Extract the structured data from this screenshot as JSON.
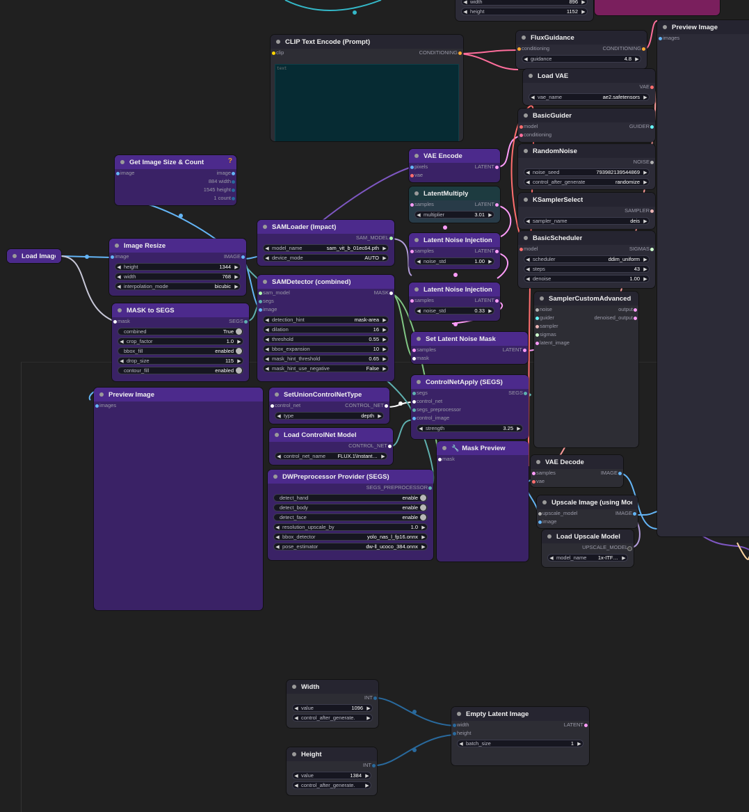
{
  "colors": {
    "canvas": "#202020",
    "image": "#64b5f6",
    "latent": "#ff9cf9",
    "conditioning": "#ffa931",
    "model": "#b39ddb",
    "mask": "#81c784",
    "segs": "#5fb1b0",
    "vae": "#ff6e6e",
    "sampler": "#ecb4b4",
    "noise": "#b0b0b0",
    "guider": "#66ffff",
    "sigmas": "#cdffcd",
    "int": "#29699c"
  },
  "nodes": {
    "top": {
      "width_label": "width",
      "width_value": "896",
      "height_label": "height",
      "height_value": "1152"
    },
    "clip": {
      "title": "CLIP Text Encode (Prompt)",
      "in_clip": "clip",
      "out_conditioning": "CONDITIONING",
      "text_placeholder": "text"
    },
    "flux": {
      "title": "FluxGuidance",
      "in_conditioning": "conditioning",
      "out_conditioning": "CONDITIONING",
      "guidance_label": "guidance",
      "guidance_value": "4.8"
    },
    "vae_loader": {
      "title": "Load VAE",
      "out_vae": "VAE",
      "vae_name_label": "vae_name",
      "vae_name_value": "ae2.safetensors"
    },
    "guider": {
      "title": "BasicGuider",
      "in_model": "model",
      "in_conditioning": "conditioning",
      "out_guider": "GUIDER"
    },
    "noise": {
      "title": "RandomNoise",
      "out_noise": "NOISE",
      "seed_label": "noise_seed",
      "seed_value": "793982139544869",
      "cag_label": "control_after_generate",
      "cag_value": "randomize"
    },
    "ksel": {
      "title": "KSamplerSelect",
      "out_sampler": "SAMPLER",
      "sampler_label": "sampler_name",
      "sampler_value": "deis"
    },
    "sched": {
      "title": "BasicScheduler",
      "in_model": "model",
      "out_sigmas": "SIGMAS",
      "scheduler_label": "scheduler",
      "scheduler_value": "ddim_uniform",
      "steps_label": "steps",
      "steps_value": "43",
      "denoise_label": "denoise",
      "denoise_value": "1.00"
    },
    "sca": {
      "title": "SamplerCustomAdvanced",
      "in_noise": "noise",
      "in_guider": "guider",
      "in_sampler": "sampler",
      "in_sigmas": "sigmas",
      "in_latent": "latent_image",
      "out_output": "output",
      "out_denoised": "denoised_output"
    },
    "preview_top": {
      "title": "Preview Image",
      "in_images": "images"
    },
    "size_count": {
      "title": "Get Image Size & Count",
      "badge": "?",
      "in_image": "image",
      "out_image": "image",
      "out_width": "884 width",
      "out_height": "1545 height",
      "out_count": "1 count"
    },
    "vae_encode": {
      "title": "VAE Encode",
      "in_pixels": "pixels",
      "in_vae": "vae",
      "out_latent": "LATENT"
    },
    "lat_mul": {
      "title": "LatentMultiply",
      "in_samples": "samples",
      "out_latent": "LATENT",
      "mult_label": "multiplier",
      "mult_value": "3.01"
    },
    "lni1": {
      "title": "Latent Noise Injection",
      "in_samples": "samples",
      "out_latent": "LATENT",
      "std_label": "noise_std",
      "std_value": "1.00"
    },
    "lni2": {
      "title": "Latent Noise Injection",
      "in_samples": "samples",
      "out_latent": "LATENT",
      "std_label": "noise_std",
      "std_value": "0.33"
    },
    "load_image": {
      "title": "Load Image"
    },
    "img_resize": {
      "title": "Image Resize",
      "in_image": "image",
      "out_image": "IMAGE",
      "height_label": "height",
      "height_value": "1344",
      "width_label": "width",
      "width_value": "768",
      "interp_label": "interpolation_mode",
      "interp_value": "bicubic"
    },
    "sam_loader": {
      "title": "SAMLoader (Impact)",
      "out_sam": "SAM_MODEL",
      "model_label": "model_name",
      "model_value": "sam_vit_b_01ec64.pth",
      "device_label": "device_mode",
      "device_value": "AUTO"
    },
    "sam_det": {
      "title": "SAMDetector (combined)",
      "in_sam": "sam_model",
      "in_segs": "segs",
      "in_image": "image",
      "out_mask": "MASK",
      "hint_label": "detection_hint",
      "hint_value": "mask-area",
      "dil_label": "dilation",
      "dil_value": "16",
      "thr_label": "threshold",
      "thr_value": "0.55",
      "bbox_label": "bbox_expansion",
      "bbox_value": "10",
      "mht_label": "mask_hint_threshold",
      "mht_value": "0.65",
      "neg_label": "mask_hint_use_negative",
      "neg_value": "False"
    },
    "mask_segs": {
      "title": "MASK to SEGS",
      "in_mask": "mask",
      "out_segs": "SEGS",
      "comb_label": "combined",
      "comb_value": "True",
      "crop_label": "crop_factor",
      "crop_value": "1.0",
      "bfill_label": "bbox_fill",
      "bfill_value": "enabled",
      "drop_label": "drop_size",
      "drop_value": "115",
      "cfill_label": "contour_fill",
      "cfill_value": "enabled"
    },
    "set_mask": {
      "title": "Set Latent Noise Mask",
      "in_samples": "samples",
      "in_mask": "mask",
      "out_latent": "LATENT"
    },
    "preview_mid": {
      "title": "Preview Image",
      "in_images": "images"
    },
    "union": {
      "title": "SetUnionControlNetType",
      "in_cn": "control_net",
      "out_cn": "CONTROL_NET",
      "type_label": "type",
      "type_value": "depth"
    },
    "cn_apply": {
      "title": "ControlNetApply (SEGS)",
      "in_segs": "segs",
      "in_cn": "control_net",
      "in_pre": "segs_preprocessor",
      "in_img": "control_image",
      "out_segs": "SEGS",
      "str_label": "strength",
      "str_value": "3.25"
    },
    "load_cn": {
      "title": "Load ControlNet Model",
      "out_cn": "CONTROL_NET",
      "name_label": "control_net_name",
      "name_value": "FLUX.1\\Instant…"
    },
    "mask_prev": {
      "title": "Mask Preview",
      "in_mask": "mask"
    },
    "vae_decode": {
      "title": "VAE Decode",
      "in_samples": "samples",
      "in_vae": "vae",
      "out_image": "IMAGE"
    },
    "dwp": {
      "title": "DWPreprocessor Provider (SEGS)",
      "out_pre": "SEGS_PREPROCESSOR",
      "hand_label": "detect_hand",
      "hand_value": "enable",
      "body_label": "detect_body",
      "body_value": "enable",
      "face_label": "detect_face",
      "face_value": "enable",
      "res_label": "resolution_upscale_by",
      "res_value": "1.0",
      "bbox_label": "bbox_detector",
      "bbox_value": "yolo_nas_l_fp16.onnx",
      "pose_label": "pose_estimator",
      "pose_value": "dw-ll_ucoco_384.onnx"
    },
    "upscale": {
      "title": "Upscale Image (using Model)",
      "in_model": "upscale_model",
      "in_image": "image",
      "out_image": "IMAGE"
    },
    "load_up": {
      "title": "Load Upscale Model",
      "out_model": "UPSCALE_MODEL",
      "name_label": "model_name",
      "name_value": "1x-ITF…"
    },
    "width_node": {
      "title": "Width",
      "out_int": "INT",
      "value_label": "value",
      "value_value": "1096",
      "cag_label": "control_after_generate."
    },
    "height_node": {
      "title": "Height",
      "out_int": "INT",
      "value_label": "value",
      "value_value": "1384",
      "cag_label": "control_after_generate."
    },
    "empty_latent": {
      "title": "Empty Latent Image",
      "in_width": "width",
      "in_height": "height",
      "out_latent": "LATENT",
      "batch_label": "batch_size",
      "batch_value": "1"
    }
  }
}
